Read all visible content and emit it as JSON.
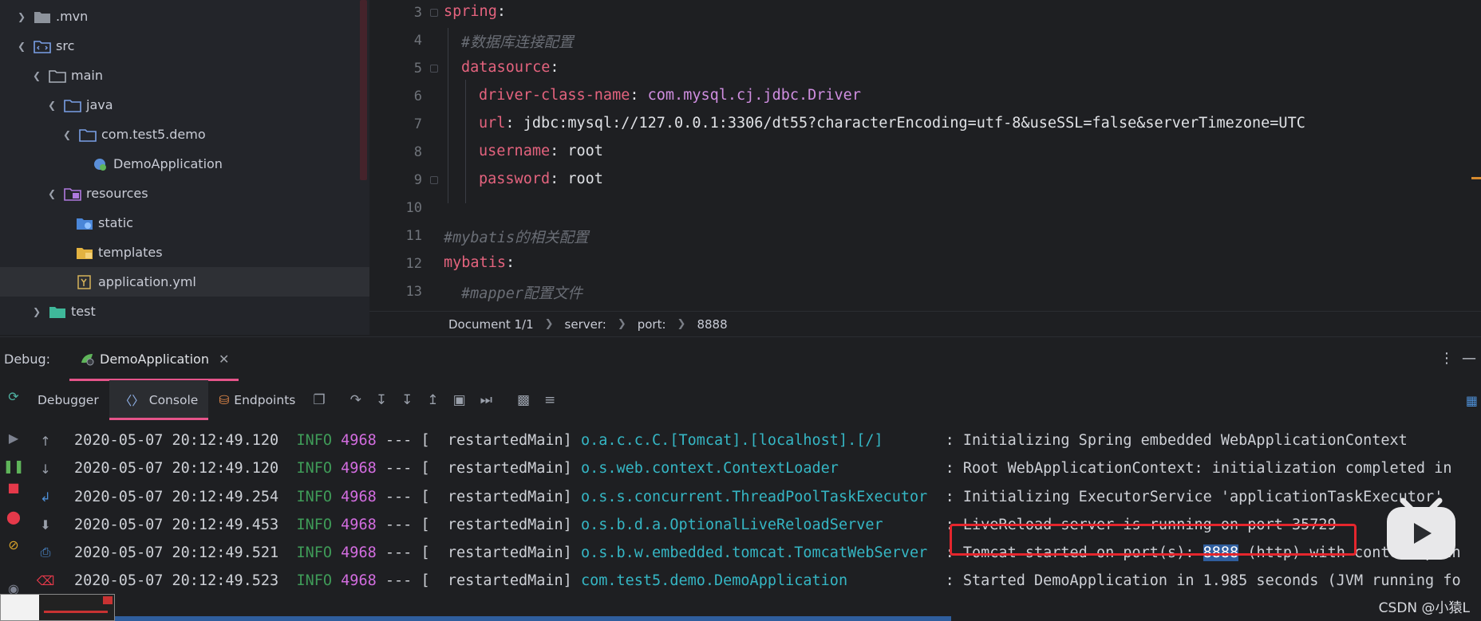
{
  "tree": {
    "items": [
      {
        "label": ".mvn",
        "expanded": false
      },
      {
        "label": "src",
        "expanded": true
      },
      {
        "label": "main",
        "expanded": true
      },
      {
        "label": "java",
        "expanded": true
      },
      {
        "label": "com.test5.demo",
        "expanded": true
      },
      {
        "label": "DemoApplication"
      },
      {
        "label": "resources",
        "expanded": true
      },
      {
        "label": "static"
      },
      {
        "label": "templates"
      },
      {
        "label": "application.yml",
        "selected": true
      },
      {
        "label": "test",
        "expanded": false
      }
    ]
  },
  "editor": {
    "line_numbers": [
      "3",
      "4",
      "5",
      "6",
      "7",
      "8",
      "9",
      "10",
      "11",
      "12",
      "13"
    ],
    "lines": [
      {
        "key": "spring",
        "colon": ":"
      },
      {
        "comment": "#数据库连接配置"
      },
      {
        "key": "datasource",
        "colon": ":"
      },
      {
        "key": "driver-class-name",
        "colon": ":",
        "value": "com.mysql.cj.jdbc.Driver"
      },
      {
        "key": "url",
        "colon": ":",
        "value": "jdbc:mysql://127.0.0.1:3306/dt55?characterEncoding=utf-8&useSSL=false&serverTimezone=UTC"
      },
      {
        "key": "username",
        "colon": ":",
        "value": "root"
      },
      {
        "key": "password",
        "colon": ":",
        "value": "root"
      },
      {},
      {
        "comment": "#mybatis的相关配置"
      },
      {
        "key": "mybatis",
        "colon": ":"
      },
      {
        "comment": "#mapper配置文件"
      }
    ]
  },
  "breadcrumb": [
    "Document 1/1",
    "server:",
    "port:",
    "8888"
  ],
  "debug": {
    "label": "Debug:",
    "tab_label": "DemoApplication",
    "tabs": [
      "Debugger",
      "Console",
      "Endpoints"
    ]
  },
  "console": {
    "lines": [
      {
        "ts": "2020-05-07 20:12:49.120",
        "level": "INFO",
        "pid": "4968",
        "sep": "---",
        "thread": "[  restartedMain]",
        "logger": "o.a.c.c.C.[Tomcat].[localhost].[/]      ",
        "msg": ": Initializing Spring embedded WebApplicationContext"
      },
      {
        "ts": "2020-05-07 20:12:49.120",
        "level": "INFO",
        "pid": "4968",
        "sep": "---",
        "thread": "[  restartedMain]",
        "logger": "o.s.web.context.ContextLoader           ",
        "msg": ": Root WebApplicationContext: initialization completed in"
      },
      {
        "ts": "2020-05-07 20:12:49.254",
        "level": "INFO",
        "pid": "4968",
        "sep": "---",
        "thread": "[  restartedMain]",
        "logger": "o.s.s.concurrent.ThreadPoolTaskExecutor ",
        "msg": ": Initializing ExecutorService 'applicationTaskExecutor'"
      },
      {
        "ts": "2020-05-07 20:12:49.453",
        "level": "INFO",
        "pid": "4968",
        "sep": "---",
        "thread": "[  restartedMain]",
        "logger": "o.s.b.d.a.OptionalLiveReloadServer      ",
        "msg": ": LiveReload server is running on port 35729"
      },
      {
        "ts": "2020-05-07 20:12:49.521",
        "level": "INFO",
        "pid": "4968",
        "sep": "---",
        "thread": "[  restartedMain]",
        "logger": "o.s.b.w.embedded.tomcat.TomcatWebServer ",
        "msg_pre": ": Tomcat started on port(s): ",
        "msg_hl": "8888",
        "msg_post": " (http) with context path"
      },
      {
        "ts": "2020-05-07 20:12:49.523",
        "level": "INFO",
        "pid": "4968",
        "sep": "---",
        "thread": "[  restartedMain]",
        "logger": "com.test5.demo.DemoApplication          ",
        "msg": ": Started DemoApplication in 1.985 seconds (JVM running fo"
      }
    ]
  },
  "watermark": "CSDN @小猿L",
  "colors": {
    "accent": "#e5548a",
    "highlight_box": "#e5262d",
    "key": "#e4637e",
    "logger": "#35b6c4",
    "pid": "#d36de0",
    "info": "#3f9b58"
  }
}
